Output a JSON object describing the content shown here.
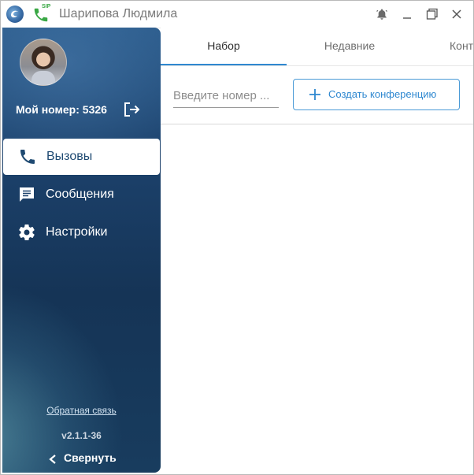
{
  "window": {
    "title": "Шарипова Людмила",
    "sip_badge": "SIP",
    "controls": [
      "notifications",
      "minimize",
      "maximize",
      "close"
    ]
  },
  "sidebar": {
    "my_number_label": "Мой номер: 5326",
    "nav": [
      {
        "label": "Вызовы",
        "icon": "phone-icon",
        "active": true
      },
      {
        "label": "Сообщения",
        "icon": "message-icon",
        "active": false
      },
      {
        "label": "Настройки",
        "icon": "gear-icon",
        "active": false
      }
    ],
    "feedback": "Обратная связь",
    "version": "v2.1.1-36",
    "collapse": "Свернуть"
  },
  "tabs": [
    {
      "label": "Набор",
      "active": true
    },
    {
      "label": "Недавние",
      "active": false
    },
    {
      "label": "Конт",
      "active": false
    }
  ],
  "dialer": {
    "number_placeholder": "Введите номер ...",
    "number_value": "",
    "create_conference": "Создать конференцию"
  },
  "colors": {
    "accent": "#2f88d0",
    "sidebar_dark": "#153456",
    "sip_green": "#3aa845"
  }
}
